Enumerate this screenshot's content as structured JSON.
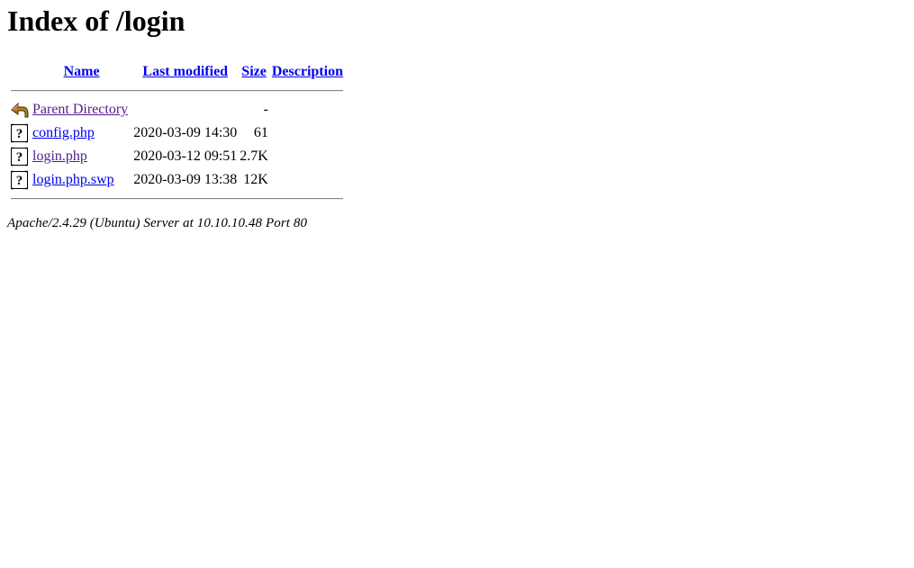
{
  "page": {
    "title": "Index of /login"
  },
  "table": {
    "headers": {
      "name": "Name",
      "last_modified": "Last modified",
      "size": "Size",
      "description": "Description"
    },
    "rows": [
      {
        "icon": "back-icon",
        "name": "Parent Directory",
        "modified": "",
        "size": "-",
        "description": "",
        "visited": true
      },
      {
        "icon": "unknown-file-icon",
        "name": "config.php",
        "modified": "2020-03-09 14:30",
        "size": "61",
        "description": "",
        "visited": false
      },
      {
        "icon": "unknown-file-icon",
        "name": "login.php",
        "modified": "2020-03-12 09:51",
        "size": "2.7K",
        "description": "",
        "visited": true
      },
      {
        "icon": "unknown-file-icon",
        "name": "login.php.swp",
        "modified": "2020-03-09 13:38",
        "size": "12K",
        "description": "",
        "visited": false
      }
    ]
  },
  "footer": {
    "address": "Apache/2.4.29 (Ubuntu) Server at 10.10.10.48 Port 80"
  },
  "colors": {
    "link": "#0000ee",
    "visited_link": "#551a8b"
  }
}
